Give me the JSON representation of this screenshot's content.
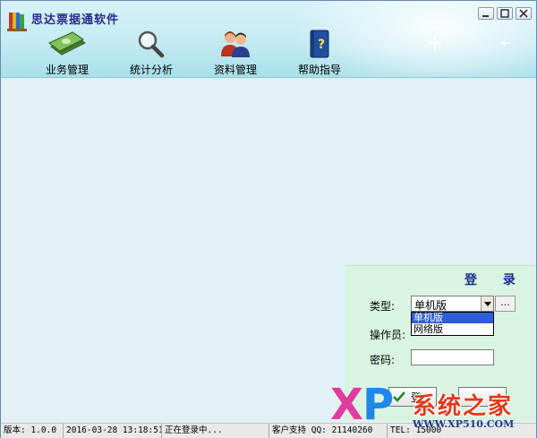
{
  "app": {
    "title": "思达票据通软件"
  },
  "toolbar": {
    "items": [
      {
        "label": "业务管理",
        "icon": "money-icon"
      },
      {
        "label": "统计分析",
        "icon": "magnifier-icon"
      },
      {
        "label": "资料管理",
        "icon": "people-icon"
      },
      {
        "label": "帮助指导",
        "icon": "help-book-icon"
      }
    ]
  },
  "login": {
    "title": "登 录",
    "type_label": "类型:",
    "type_value": "单机版",
    "more_label": "...",
    "options": [
      "单机版",
      "网络版"
    ],
    "operator_label": "操作员:",
    "password_label": "密码:",
    "login_button": "登"
  },
  "status": {
    "version": "版本: 1.0.0",
    "datetime": "2016-03-28 13:18:51",
    "message": "正在登录中...",
    "support": "客户支持 QQ: 21140260",
    "tel": "TEL: 15000"
  },
  "watermark": {
    "x": "X",
    "p": "P",
    "name": "系统之家",
    "url": "WWW.XP510.COM"
  },
  "colors": {
    "title_text": "#2a2a8a",
    "login_panel": "#d9f5e2",
    "workspace": "#e2f1f6",
    "selection": "#2d5ed8"
  }
}
